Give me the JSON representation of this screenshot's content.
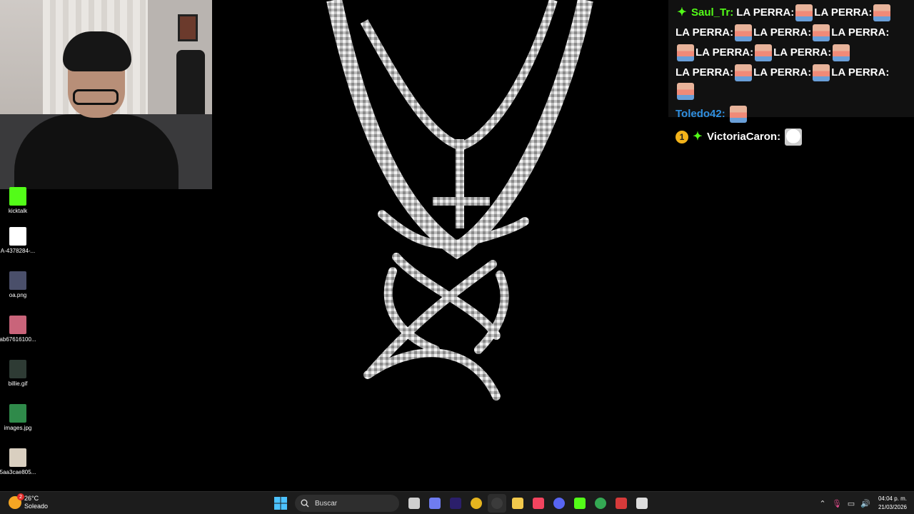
{
  "desktop_icons": [
    {
      "label": "kicktalk",
      "color": "#53fc18"
    },
    {
      "label": "A-4378284-...",
      "color": "#ffffff"
    },
    {
      "label": "oa.png",
      "color": "#4a4f6a"
    },
    {
      "label": "ab67616100...",
      "color": "#c9647a"
    },
    {
      "label": "billie.gif",
      "color": "#2e3b34"
    },
    {
      "label": "images.jpg",
      "color": "#2f8a4a"
    },
    {
      "label": "5aa3cae805...",
      "color": "#d9cfc0"
    }
  ],
  "chat": {
    "lines": [
      {
        "user": "Saul_Tr:",
        "user_color": "#53fc18",
        "badge": "sprout",
        "message": [
          "LA PERRA:",
          "LA PERRA:",
          "LA PERRA:",
          "LA PERRA:",
          "LA PERRA:",
          "LA PERRA:",
          "LA PERRA:",
          "LA PERRA:",
          "LA PERRA:",
          "LA PERRA:"
        ]
      },
      {
        "user": "Toledo42:",
        "user_color": "#2f8fe0",
        "badge": "",
        "message": []
      },
      {
        "user": "VictoriaCaron:",
        "user_color": "#ffffff",
        "badge": "one-sprout",
        "message": []
      }
    ],
    "badge_one": "1"
  },
  "taskbar": {
    "weather_temp": "26°C",
    "weather_cond": "Soleado",
    "weather_notif": "2",
    "search_placeholder": "Buscar",
    "time": "04:04 p. m.",
    "date": "21/03/2026",
    "apps": [
      {
        "name": "file-explorer-task-view-icon",
        "color": "#cfcfcf"
      },
      {
        "name": "copilot-icon",
        "color": "#6f7cf0"
      },
      {
        "name": "premiere-icon",
        "color": "#2b1f6b"
      },
      {
        "name": "chrome-icon",
        "color": "#e5b41f"
      },
      {
        "name": "obs-icon",
        "color": "#3b3b3b"
      },
      {
        "name": "folder-icon",
        "color": "#f2c94c"
      },
      {
        "name": "itunes-icon",
        "color": "#f2445f"
      },
      {
        "name": "discord-icon",
        "color": "#5865f2"
      },
      {
        "name": "kick-icon",
        "color": "#53fc18"
      },
      {
        "name": "chrome-profile-icon",
        "color": "#34a853"
      },
      {
        "name": "recorder-icon",
        "color": "#d63a3a"
      },
      {
        "name": "app-icon",
        "color": "#dddddd"
      }
    ]
  }
}
